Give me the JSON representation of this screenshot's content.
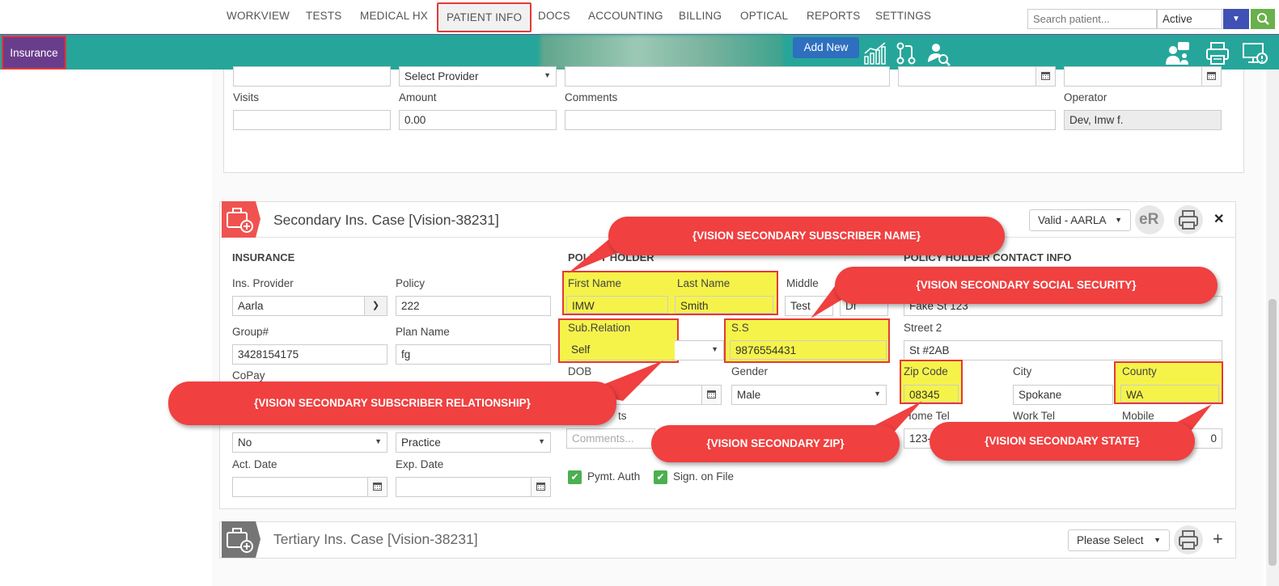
{
  "nav": {
    "items": [
      "WORKVIEW",
      "TESTS",
      "MEDICAL HX",
      "PATIENT INFO",
      "DOCS",
      "ACCOUNTING",
      "BILLING",
      "OPTICAL",
      "REPORTS",
      "SETTINGS"
    ],
    "search_placeholder": "Search patient...",
    "status": "Active"
  },
  "toolbar": {
    "insurance_tab": "Insurance",
    "add_new": "Add New"
  },
  "upper": {
    "select_provider": "Select Provider",
    "visits_label": "Visits",
    "amount_label": "Amount",
    "amount_value": "0.00",
    "comments_label": "Comments",
    "operator_label": "Operator",
    "operator_value": "Dev, Imw f."
  },
  "secondary": {
    "title": "Secondary Ins. Case [Vision-38231]",
    "status": "Valid - AARLA",
    "er_label": "eR",
    "close": "✕",
    "insurance_header": "INSURANCE",
    "policy_holder_header": "POLICY HOLDER",
    "contact_header": "POLICY HOLDER CONTACT INFO",
    "ins_provider_label": "Ins. Provider",
    "ins_provider_value": "Aarla",
    "policy_label": "Policy",
    "policy_value": "222",
    "group_label": "Group#",
    "group_value": "3428154175",
    "plan_label": "Plan Name",
    "plan_value": "fg",
    "copay_label": "CoPay",
    "copay_select_value": "No",
    "practice_value": "Practice",
    "act_date_label": "Act. Date",
    "exp_date_label": "Exp. Date",
    "first_name_label": "First Name",
    "first_name_value": "IMW",
    "last_name_label": "Last Name",
    "last_name_value": "Smith",
    "middle_label": "Middle",
    "middle_value": "Test",
    "suffix_value": "Df",
    "sub_relation_label": "Sub.Relation",
    "sub_relation_value": "Self",
    "ss_label": "S.S",
    "ss_value": "9876554431",
    "dob_label": "DOB",
    "dob_value": "0",
    "gender_label": "Gender",
    "gender_value": "Male",
    "comments_label_partial": "ts",
    "comments_placeholder": "Comments...",
    "pymt_auth": "Pymt. Auth",
    "sign_on_file": "Sign. on File",
    "street_value": "Fake St 123",
    "street2_label": "Street 2",
    "street2_value": "St #2AB",
    "zip_label": "Zip Code",
    "zip_value": "08345",
    "city_label": "City",
    "city_value": "Spokane",
    "county_label": "County",
    "county_value": "WA",
    "home_tel_label": "Home Tel",
    "home_tel_value": "123-",
    "work_tel_label": "Work Tel",
    "mobile_label": "Mobile",
    "mobile_value_partial": "0"
  },
  "callouts": {
    "subscriber_name": "{VISION SECONDARY SUBSCRIBER NAME}",
    "social_security": "{VISION SECONDARY SOCIAL SECURITY}",
    "relationship": "{VISION SECONDARY SUBSCRIBER RELATIONSHIP}",
    "zip": "{VISION SECONDARY ZIP}",
    "state": "{VISION SECONDARY STATE}"
  },
  "tertiary": {
    "title": "Tertiary Ins. Case [Vision-38231]",
    "select": "Please Select",
    "plus": "+"
  },
  "colors": {
    "teal": "#26a69a",
    "purple": "#6a3d8c",
    "callout_red": "#f04040",
    "highlight_yellow": "#f5f34a",
    "primary_blue": "#2f6fbf"
  }
}
